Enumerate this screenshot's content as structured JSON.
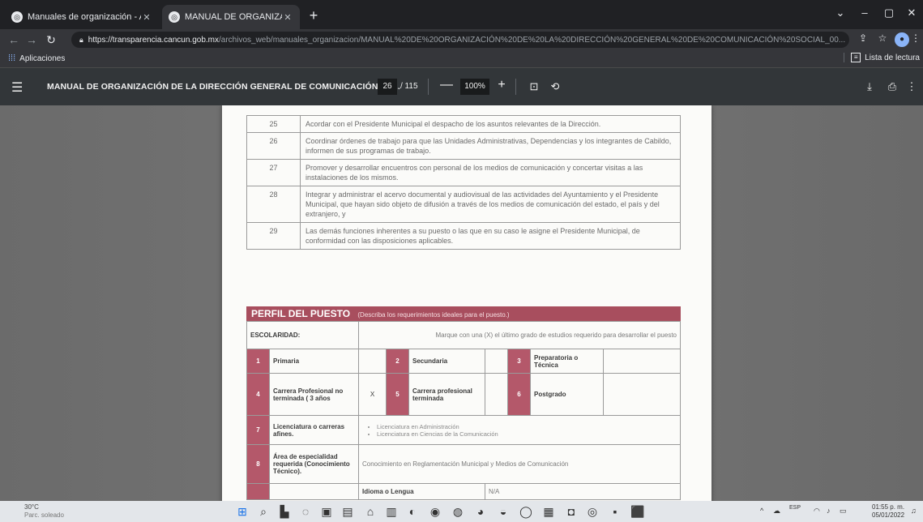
{
  "browser": {
    "tabs": [
      {
        "title": "Manuales de organización - Ayu",
        "close": "✕"
      },
      {
        "title": "MANUAL DE ORGANIZACION DI",
        "close": "✕"
      }
    ],
    "new_tab": "+",
    "address": {
      "host": "https://transparencia.cancun.gob.mx",
      "path": "/archivos_web/manuales_organizacion/MANUAL%20DE%20ORGANIZACIÓN%20DE%20LA%20DIRECCIÓN%20GENERAL%20DE%20COMUNICACIÓN%20SOCIAL_00..."
    },
    "bookmarks": {
      "apps_label": "Aplicaciones",
      "reading_list_label": "Lista de lectura"
    }
  },
  "pdf_viewer": {
    "title": "MANUAL DE ORGANIZACIÓN DE LA DIRECCIÓN GENERAL DE COMUNICACIÓN SO...",
    "current_page": "26",
    "total_pages": "/ 115",
    "zoom": "100%",
    "zoom_out": "—",
    "zoom_in": "+"
  },
  "document": {
    "functions": [
      {
        "num": "25",
        "text": "Acordar con el Presidente Municipal el despacho de los asuntos relevantes de la Dirección."
      },
      {
        "num": "26",
        "text": "Coordinar órdenes de trabajo para que las Unidades Administrativas, Dependencias y los integrantes de Cabildo, informen de sus programas de trabajo."
      },
      {
        "num": "27",
        "text": "Promover y desarrollar encuentros con personal de los medios de comunicación y concertar visitas a las instalaciones de los mismos."
      },
      {
        "num": "28",
        "text": "Integrar y administrar el acervo documental y audiovisual de las actividades del Ayuntamiento y el Presidente Municipal, que hayan sido objeto de difusión a través de los medios de comunicación del estado, el país y del extranjero, y"
      },
      {
        "num": "29",
        "text": "Las demás funciones inherentes a su puesto o las que en su caso le asigne el Presidente Municipal, de conformidad con las disposiciones aplicables."
      }
    ],
    "perfil": {
      "heading": "PERFIL DEL PUESTO",
      "subheading": "(Describa los requerimientos ideales para el puesto.)",
      "escolaridad_label": "ESCOLARIDAD:",
      "escolaridad_instruction": "Marque con una (X) el último grado de estudios requerido para desarrollar el puesto",
      "levels": [
        {
          "num": "1",
          "label": "Primaria",
          "mark": ""
        },
        {
          "num": "2",
          "label": "Secundaria",
          "mark": ""
        },
        {
          "num": "3",
          "label": "Preparatoria o Técnica",
          "mark": ""
        },
        {
          "num": "4",
          "label": "Carrera Profesional no terminada ( 3 años",
          "mark": "X"
        },
        {
          "num": "5",
          "label": "Carrera profesional terminada",
          "mark": ""
        },
        {
          "num": "6",
          "label": "Postgrado",
          "mark": ""
        }
      ],
      "licenciatura": {
        "num": "7",
        "label": "Licenciatura o carreras afines.",
        "items": [
          "Licenciatura en Administración",
          "Licenciatura en Ciencias de la Comunicación"
        ]
      },
      "especialidad": {
        "num": "8",
        "label": "Área de especialidad requerida (Conocimiento Técnico).",
        "value": "Conocimiento en Reglamentación Municipal y Medios de Comunicación"
      },
      "idioma": {
        "label": "Idioma o Lengua",
        "value": "N/A"
      }
    }
  },
  "taskbar": {
    "weather_temp": "30°C",
    "weather_cond": "Parc. soleado",
    "lang": "ESP",
    "time": "01:55 p. m.",
    "date": "05/01/2022"
  }
}
